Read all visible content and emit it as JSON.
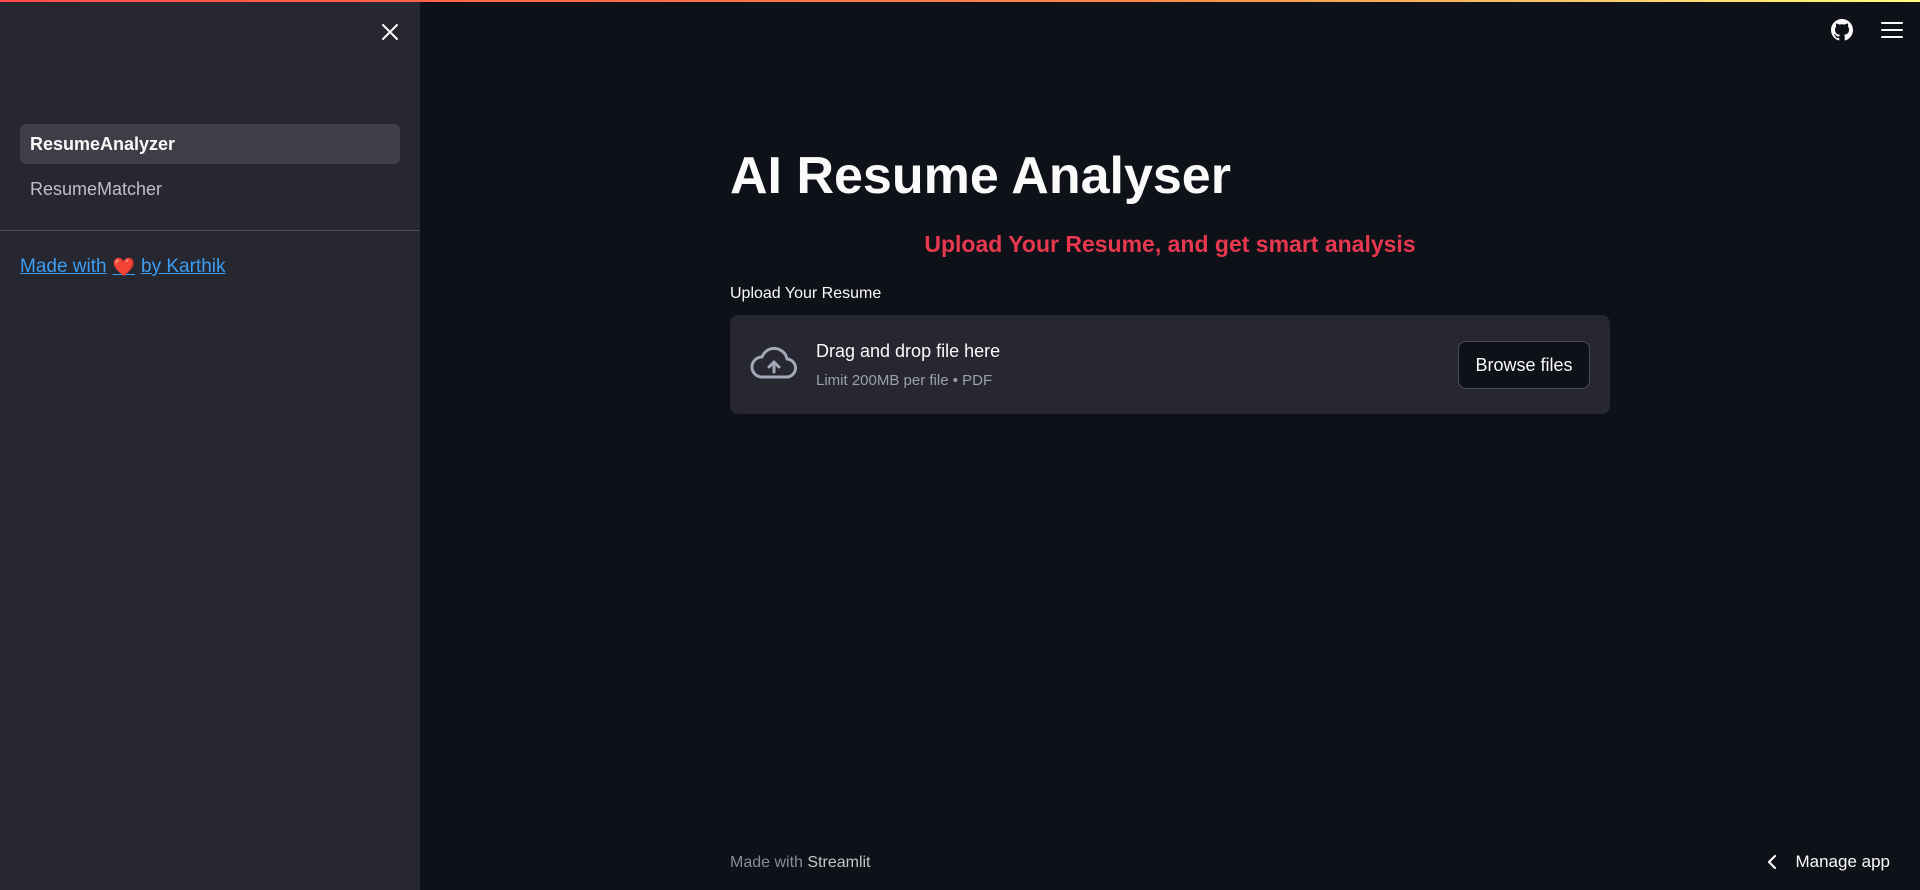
{
  "sidebar": {
    "items": [
      {
        "label": "ResumeAnalyzer",
        "active": true
      },
      {
        "label": "ResumeMatcher",
        "active": false
      }
    ],
    "credit": {
      "prefix": "Made with",
      "heart": "❤️",
      "suffix": "by Karthik"
    }
  },
  "header": {
    "icons": [
      "github-icon",
      "hamburger-menu-icon"
    ]
  },
  "main": {
    "title": "AI Resume Analyser",
    "subtitle": "Upload Your Resume, and get smart analysis",
    "uploader": {
      "label": "Upload Your Resume",
      "drop_text": "Drag and drop file here",
      "hint": "Limit 200MB per file • PDF",
      "button": "Browse files"
    }
  },
  "footer": {
    "prefix": "Made with",
    "brand": "Streamlit"
  },
  "manage_app": {
    "label": "Manage app"
  },
  "colors": {
    "background": "#0e1117",
    "sidebar": "#262730",
    "accent_red": "#e8384f",
    "link_blue": "#3d9df3"
  }
}
